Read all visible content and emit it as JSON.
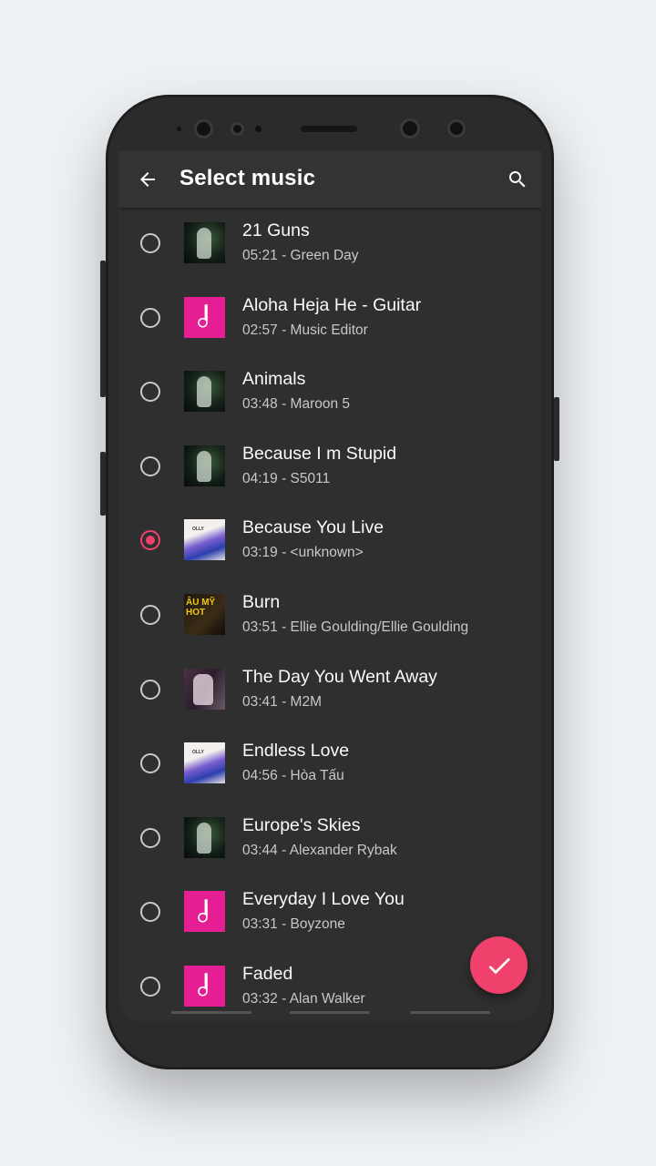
{
  "app_bar": {
    "title": "Select music",
    "back_icon": "arrow-back-icon",
    "search_icon": "search-icon"
  },
  "colors": {
    "accent": "#f0406c",
    "pink_art": "#e61e94",
    "background": "#2f2f2f"
  },
  "songs": [
    {
      "title": "21 Guns",
      "meta": "05:21 - Green Day",
      "art": "greenday",
      "selected": false
    },
    {
      "title": "Aloha Heja He - Guitar",
      "meta": "02:57 - Music Editor",
      "art": "note",
      "selected": false
    },
    {
      "title": "Animals",
      "meta": "03:48 - Maroon 5",
      "art": "greenday",
      "selected": false
    },
    {
      "title": "Because I m Stupid",
      "meta": "04:19 - S5011",
      "art": "greenday",
      "selected": false
    },
    {
      "title": "Because You Live",
      "meta": "03:19 - <unknown>",
      "art": "olly",
      "selected": true
    },
    {
      "title": "Burn",
      "meta": "03:51 - Ellie Goulding/Ellie Goulding",
      "art": "aumy",
      "selected": false
    },
    {
      "title": "The Day You Went Away",
      "meta": "03:41 - M2M",
      "art": "m2m",
      "selected": false
    },
    {
      "title": "Endless Love",
      "meta": "04:56 - Hòa Tấu",
      "art": "olly",
      "selected": false
    },
    {
      "title": "Europe's Skies",
      "meta": "03:44 - Alexander Rybak",
      "art": "greenday",
      "selected": false
    },
    {
      "title": "Everyday I Love You",
      "meta": "03:31 - Boyzone",
      "art": "note",
      "selected": false
    },
    {
      "title": "Faded",
      "meta": "03:32 - Alan Walker",
      "art": "note",
      "selected": false
    }
  ],
  "fab": {
    "icon": "check-icon"
  }
}
